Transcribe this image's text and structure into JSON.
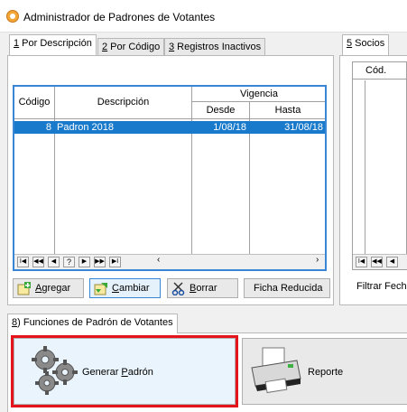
{
  "window": {
    "title": "Administrador de Padrones de Votantes"
  },
  "tabs": [
    {
      "key": "1",
      "label": " Por Descripción"
    },
    {
      "key": "2",
      "label": " Por Código"
    },
    {
      "key": "3",
      "label": " Registros Inactivos"
    }
  ],
  "right_tab": {
    "key": "5",
    "label": " Socios"
  },
  "grid": {
    "columns": {
      "codigo": "Código",
      "descripcion": "Descripción",
      "vigencia": "Vigencia",
      "desde": "Desde",
      "hasta": "Hasta"
    },
    "rows": [
      {
        "codigo": "8",
        "descripcion": "Padron 2018",
        "desde": "1/08/18",
        "hasta": "31/08/18"
      }
    ],
    "nav": {
      "first": "I◀",
      "prev_page": "◀◀",
      "prev": "◀",
      "query": "?",
      "next": "▶",
      "next_page": "▶▶",
      "last": "▶I"
    }
  },
  "right_grid": {
    "col": "Cód.",
    "filter_label": "Filtrar Fecha"
  },
  "buttons": {
    "agregar": {
      "hotkey": "A",
      "rest": "gregar"
    },
    "cambiar": {
      "hotkey": "C",
      "rest": "ambiar"
    },
    "borrar": {
      "hotkey": "B",
      "rest": "orrar"
    },
    "ficha": "Ficha Reducida"
  },
  "functions_tab": {
    "key": "8",
    "label": ") Funciones de Padrón de Votantes"
  },
  "actions": {
    "generar": {
      "pre": "Generar ",
      "hotkey": "P",
      "rest": "adrón"
    },
    "reporte": "Reporte"
  },
  "colors": {
    "selection": "#1979ca",
    "highlight_border": "#e5141c",
    "grid_border": "#3a86d6"
  },
  "icons": [
    "app-icon",
    "agregar-icon",
    "cambiar-icon",
    "borrar-icon",
    "gears-icon",
    "printer-icon"
  ]
}
